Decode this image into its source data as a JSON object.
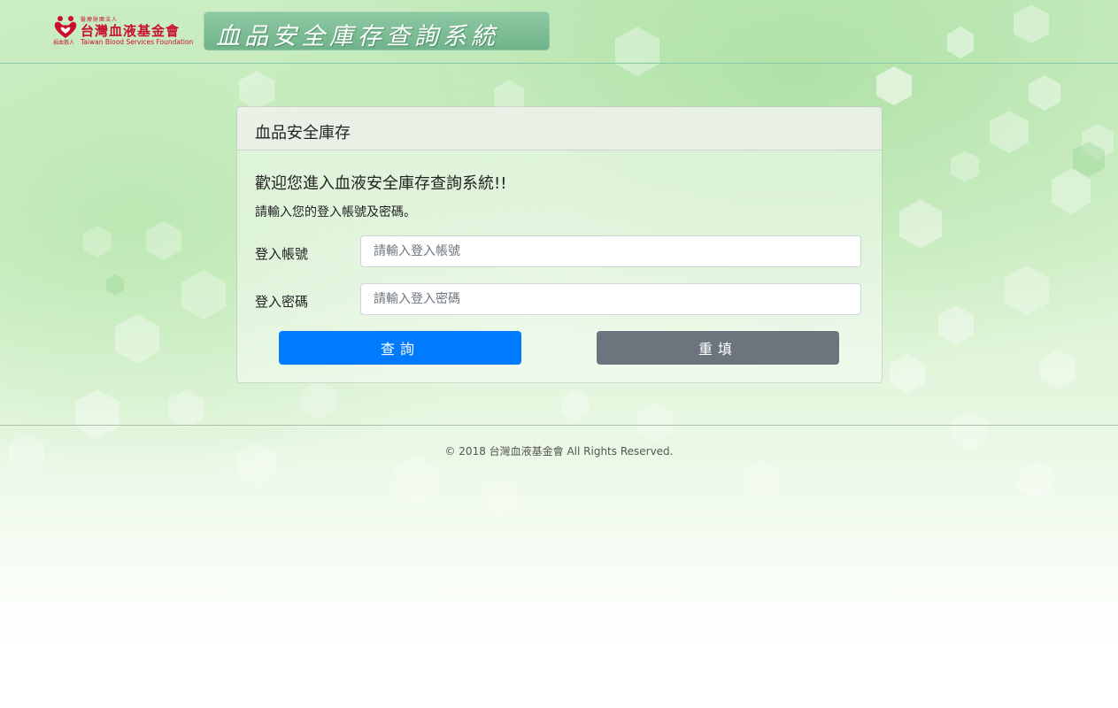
{
  "header": {
    "logo": {
      "small_top": "醫療財團法人",
      "name_cn": "台灣血液基金會",
      "small_left": "捐血救人",
      "name_en": "Taiwan Blood Services Foundation"
    },
    "banner_title": "血品安全庫存查詢系統"
  },
  "card": {
    "title": "血品安全庫存",
    "welcome": "歡迎您進入血液安全庫存查詢系統!!",
    "instruction": "請輸入您的登入帳號及密碼。",
    "username": {
      "label": "登入帳號",
      "value": "",
      "placeholder": "請輸入登入帳號"
    },
    "password": {
      "label": "登入密碼",
      "value": "",
      "placeholder": "請輸入登入密碼"
    },
    "query_button": "查詢",
    "reset_button": "重填"
  },
  "footer": {
    "copyright": "© 2018 台灣血液基金會 All Rights Reserved."
  },
  "colors": {
    "primary": "#007bff",
    "secondary": "#6c757d",
    "brand_red": "#c8102e",
    "banner": "#7dbd96"
  },
  "icons": {
    "logo_mark": "blood-drop-heart-icon"
  }
}
